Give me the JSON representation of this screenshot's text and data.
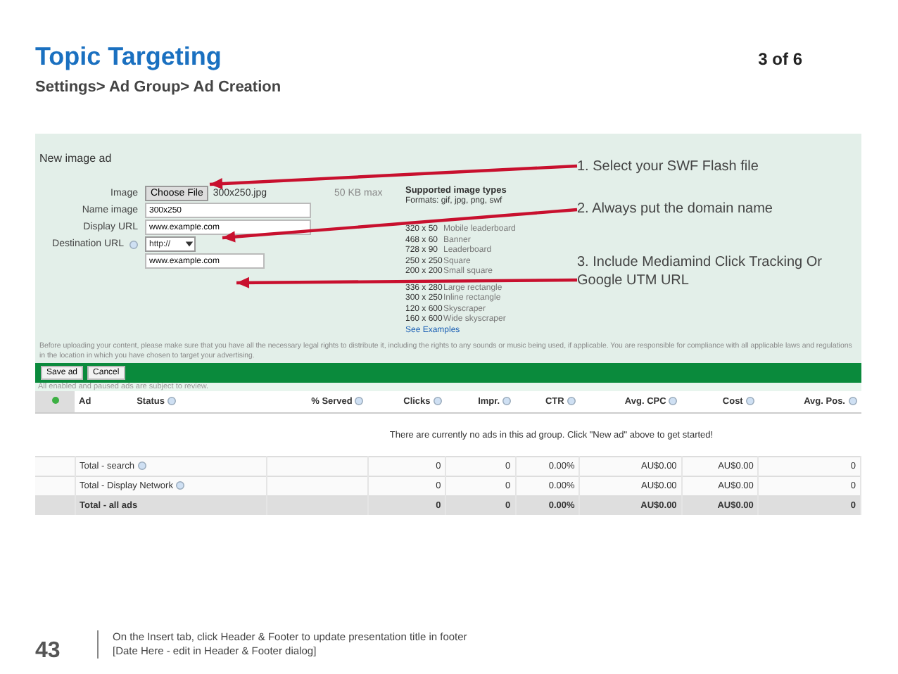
{
  "slide": {
    "title": "Topic Targeting",
    "page_indicator": "3 of 6",
    "breadcrumb": "Settings> Ad Group> Ad Creation"
  },
  "ad_form": {
    "heading": "New image ad",
    "fields": [
      {
        "label": "Image",
        "kind": "file",
        "help": false,
        "button": "Choose File",
        "value": "300x250.jpg",
        "note": "50 KB max"
      },
      {
        "label": "Name image",
        "kind": "text",
        "help": false,
        "value": "300x250"
      },
      {
        "label": "Display URL",
        "kind": "text",
        "help": false,
        "value": "www.example.com"
      },
      {
        "label": "Destination URL",
        "kind": "url",
        "help": true,
        "select": "http://",
        "value": "www.example.com"
      }
    ]
  },
  "image_types": {
    "title": "Supported image types",
    "formats": "Formats: gif, jpg, png, swf",
    "sizes": [
      {
        "size": "320 x 50",
        "name": "Mobile leaderboard"
      },
      {
        "size": "468 x 60",
        "name": "Banner"
      },
      {
        "size": "728 x 90",
        "name": "Leaderboard"
      },
      {
        "size": "250 x 250",
        "name": "Square"
      },
      {
        "size": "200 x 200",
        "name": "Small square"
      },
      {
        "size": "336 x 280",
        "name": "Large rectangle"
      },
      {
        "size": "300 x 250",
        "name": "Inline rectangle"
      },
      {
        "size": "120 x 600",
        "name": "Skyscraper"
      },
      {
        "size": "160 x 600",
        "name": "Wide skyscraper"
      }
    ],
    "link": "See Examples"
  },
  "annotations": [
    "1. Select your SWF Flash file",
    "2. Always put the domain name",
    "3. Include Mediamind Click Tracking Or Google UTM URL"
  ],
  "disclaimer": "Before uploading your content, please make sure that you have all the necessary legal rights to distribute it, including the rights to any sounds or music being used, if applicable. You are responsible for compliance with all applicable laws and regulations in the location in which you have chosen to target your advertising.",
  "buttons": [
    "Save ad",
    "Cancel"
  ],
  "table_note": "All enabled and paused ads are subject to review.",
  "table": {
    "columns": [
      {
        "label": "Ad",
        "help": false
      },
      {
        "label": "Status",
        "help": true
      },
      {
        "label": "% Served",
        "help": true
      },
      {
        "label": "Clicks",
        "help": true
      },
      {
        "label": "Impr.",
        "help": true
      },
      {
        "label": "CTR",
        "help": true
      },
      {
        "label": "Avg. CPC",
        "help": true
      },
      {
        "label": "Cost",
        "help": true
      },
      {
        "label": "Avg. Pos.",
        "help": true
      }
    ],
    "empty_message": "There are currently no ads in this ad group. Click \"New ad\" above to get started!",
    "rows": [
      {
        "kind": "subtotal",
        "label": "Total - search",
        "help": true,
        "values": [
          "0",
          "0",
          "0.00%",
          "AU$0.00",
          "AU$0.00",
          "0"
        ]
      },
      {
        "kind": "subtotal",
        "label": "Total - Display Network",
        "help": true,
        "values": [
          "0",
          "0",
          "0.00%",
          "AU$0.00",
          "AU$0.00",
          "0"
        ]
      },
      {
        "kind": "grand_total",
        "label": "Total - all ads",
        "help": false,
        "values": [
          "0",
          "0",
          "0.00%",
          "AU$0.00",
          "AU$0.00",
          "0"
        ]
      }
    ]
  },
  "footer": {
    "page_number": "43",
    "lines": [
      "On the Insert tab, click Header & Footer to update presentation title in footer",
      "[Date Here - edit in Header & Footer dialog]"
    ]
  }
}
